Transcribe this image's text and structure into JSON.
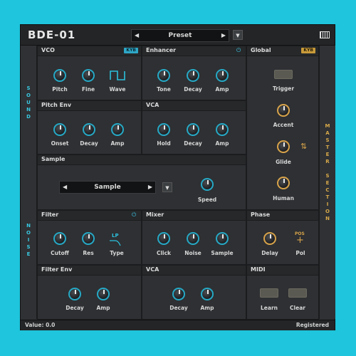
{
  "header": {
    "title": "BDE-01",
    "preset": "Preset"
  },
  "sidebar_left": {
    "top": "SOUND",
    "bottom": "NOISE"
  },
  "sidebar_right": {
    "label": "MASTER SECTION"
  },
  "vco": {
    "title": "VCO",
    "badge": "KYB",
    "pitch": "Pitch",
    "fine": "Fine",
    "wave": "Wave"
  },
  "enhancer": {
    "title": "Enhancer",
    "tone": "Tone",
    "decay": "Decay",
    "amp": "Amp"
  },
  "global": {
    "title": "Global",
    "badge": "KYB",
    "trigger": "Trigger",
    "accent": "Accent",
    "glide": "Glide",
    "human": "Human"
  },
  "pitch_env": {
    "title": "Pitch Env",
    "onset": "Onset",
    "decay": "Decay",
    "amp": "Amp"
  },
  "vca1": {
    "title": "VCA",
    "hold": "Hold",
    "decay": "Decay",
    "amp": "Amp"
  },
  "sample": {
    "title": "Sample",
    "selector": "Sample",
    "speed": "Speed"
  },
  "filter": {
    "title": "Filter",
    "cutoff": "Cutoff",
    "res": "Res",
    "type": "Type",
    "type_value": "LP"
  },
  "mixer": {
    "title": "Mixer",
    "click": "Click",
    "noise": "Noise",
    "sample": "Sample"
  },
  "phase": {
    "title": "Phase",
    "delay": "Delay",
    "pol": "Pol",
    "pol_value": "POS"
  },
  "filter_env": {
    "title": "Filter Env",
    "decay": "Decay",
    "amp": "Amp"
  },
  "vca2": {
    "title": "VCA",
    "decay": "Decay",
    "amp": "Amp"
  },
  "midi": {
    "title": "MIDI",
    "learn": "Learn",
    "clear": "Clear"
  },
  "status": {
    "value": "Value: 0.0",
    "registration": "Registered"
  },
  "colors": {
    "background": "#1ec5dc",
    "accent_blue": "#26a9c6",
    "accent_gold": "#d8a34a"
  }
}
